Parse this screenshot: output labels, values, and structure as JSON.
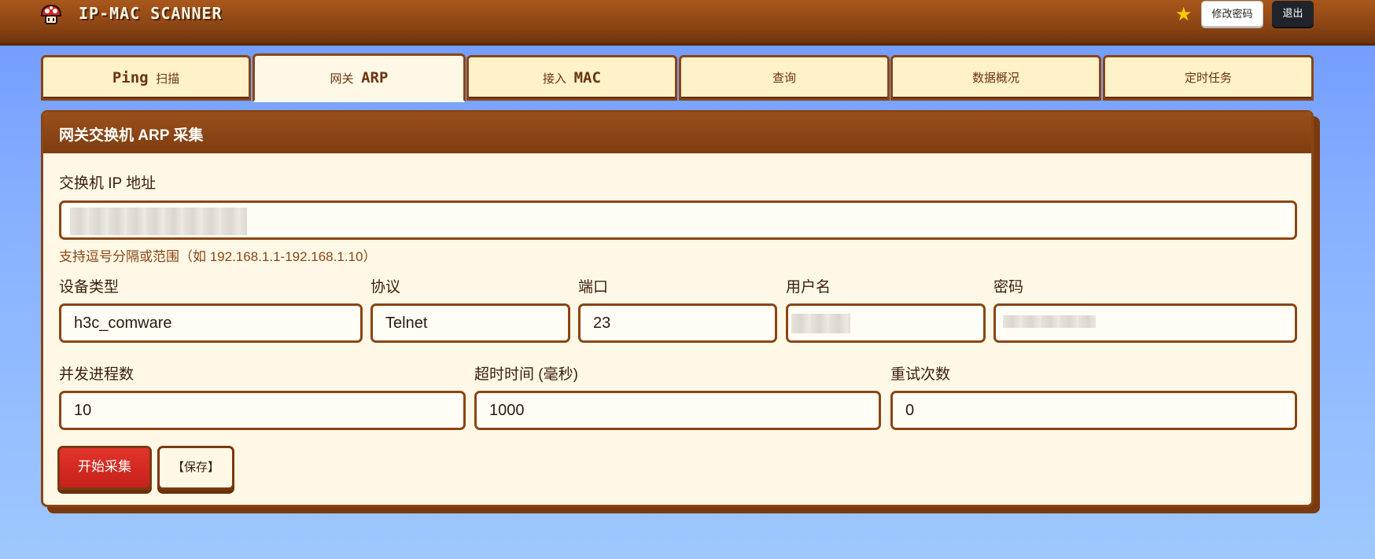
{
  "app": {
    "title": "IP-MAC SCANNER",
    "change_password": "修改密码",
    "logout": "退出",
    "logo_icon": "mushroom-icon",
    "star_icon": "star-icon"
  },
  "tabs": [
    {
      "mono": "Ping",
      "cjk_after": "扫描",
      "active": false
    },
    {
      "cjk_before": "网关",
      "mono": "ARP",
      "active": true
    },
    {
      "cjk_before": "接入",
      "mono": "MAC",
      "active": false
    },
    {
      "cjk_before": "查询",
      "active": false
    },
    {
      "cjk_before": "数据概况",
      "active": false
    },
    {
      "cjk_before": "定时任务",
      "active": false
    }
  ],
  "panel": {
    "title": "网关交换机 ARP 采集",
    "ip": {
      "label": "交换机 IP 地址",
      "value": "",
      "hint": "支持逗号分隔或范围（如 192.168.1.1-192.168.1.10）"
    },
    "device_type": {
      "label": "设备类型",
      "value": "h3c_comware"
    },
    "protocol": {
      "label": "协议",
      "value": "Telnet"
    },
    "port": {
      "label": "端口",
      "value": "23"
    },
    "username": {
      "label": "用户名",
      "value": ""
    },
    "password": {
      "label": "密码",
      "value": ""
    },
    "concurrency": {
      "label": "并发进程数",
      "value": "10"
    },
    "timeout": {
      "label": "超时时间 (毫秒)",
      "value": "1000"
    },
    "retries": {
      "label": "重试次数",
      "value": "0"
    },
    "start_button": "开始采集",
    "save_button": "【保存】"
  },
  "colors": {
    "brand_brown": "#8b4513",
    "header_brown": "#7e3d10",
    "tab_bg": "#fff1c8",
    "panel_bg": "#fff8e6",
    "start_red": "#d62a22",
    "star_yellow": "#ffcc00",
    "background_blue": "#86b0ff"
  }
}
